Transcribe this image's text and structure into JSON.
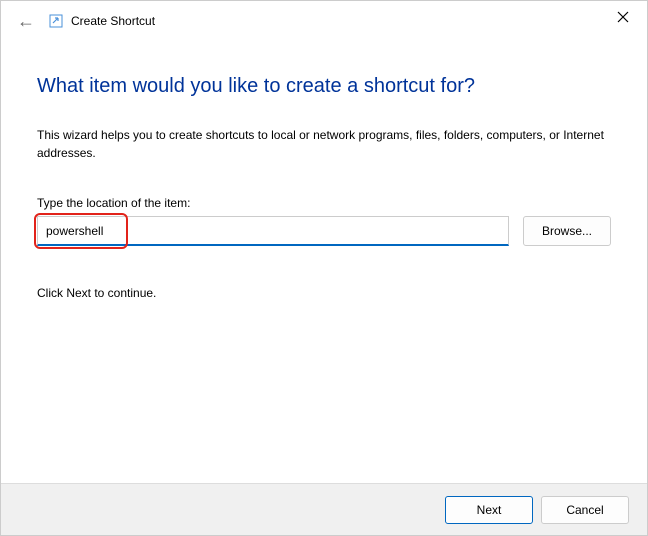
{
  "window": {
    "title": "Create Shortcut",
    "close_label": "✕"
  },
  "main": {
    "heading": "What item would you like to create a shortcut for?",
    "description": "This wizard helps you to create shortcuts to local or network programs, files, folders, computers, or Internet addresses.",
    "input_label": "Type the location of the item:",
    "input_value": "powershell",
    "browse_label": "Browse...",
    "continue_text": "Click Next to continue."
  },
  "footer": {
    "next_label": "Next",
    "cancel_label": "Cancel"
  }
}
